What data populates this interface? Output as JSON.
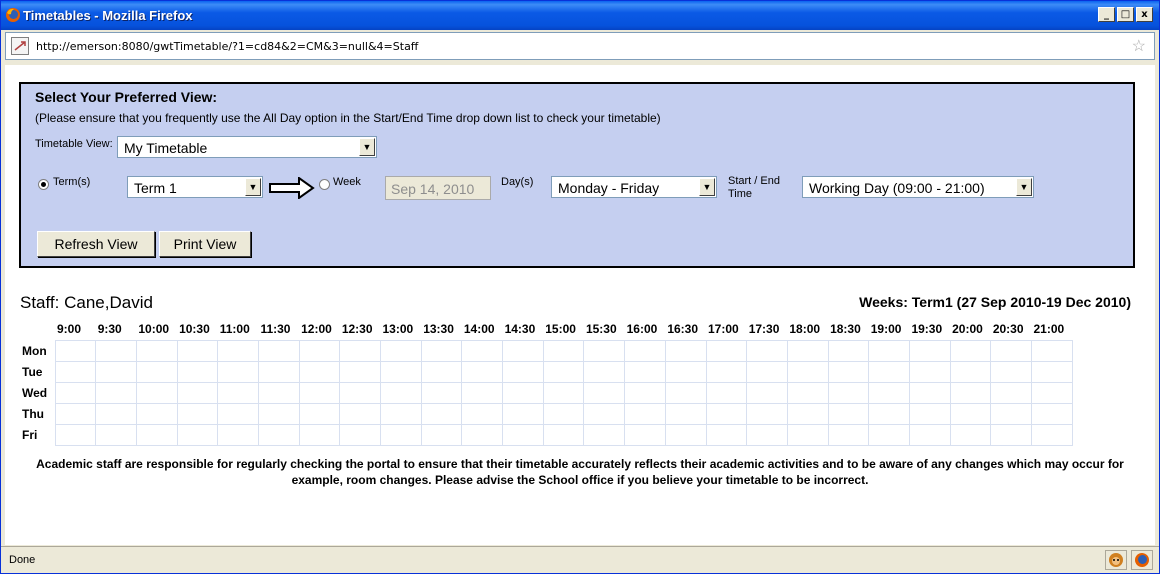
{
  "window": {
    "title": "Timetables - Mozilla Firefox",
    "minimize": "_",
    "maximize": "□",
    "close": "x"
  },
  "browser": {
    "url": "http://emerson:8080/gwtTimetable/?1=cd84&2=CM&3=null&4=Staff",
    "status": "Done"
  },
  "panel": {
    "heading": "Select Your Preferred View:",
    "note": "(Please ensure that you frequently use the All Day option in the Start/End Time drop down list to check your timetable)",
    "timetable_view_label": "Timetable View:",
    "timetable_view_value": "My Timetable",
    "term_label": "Term(s)",
    "term_value": "Term 1",
    "week_label": "Week",
    "week_value": "Sep 14, 2010",
    "days_label": "Day(s)",
    "days_value": "Monday - Friday",
    "start_end_label_1": "Start / End",
    "start_end_label_2": "Time",
    "start_end_value": "Working Day (09:00 - 21:00)",
    "refresh_label": "Refresh View",
    "print_label": "Print View"
  },
  "timetable": {
    "staff": "Staff: Cane,David",
    "weeks": "Weeks: Term1 (27 Sep 2010-19 Dec 2010)",
    "times": [
      "9:00",
      "9:30",
      "10:00",
      "10:30",
      "11:00",
      "11:30",
      "12:00",
      "12:30",
      "13:00",
      "13:30",
      "14:00",
      "14:30",
      "15:00",
      "15:30",
      "16:00",
      "16:30",
      "17:00",
      "17:30",
      "18:00",
      "18:30",
      "19:00",
      "19:30",
      "20:00",
      "20:30",
      "21:00"
    ],
    "days": [
      "Mon",
      "Tue",
      "Wed",
      "Thu",
      "Fri"
    ],
    "footnote": "Academic staff are responsible for regularly checking the portal to ensure that their timetable accurately reflects their academic activities and to be aware of any changes which may occur for example, room changes. Please advise the School office if you believe your timetable to be incorrect."
  },
  "icons": {
    "app": "firefox-icon",
    "site": "page-icon",
    "bookmark": "star-icon",
    "arrow": "right-arrow-icon"
  }
}
